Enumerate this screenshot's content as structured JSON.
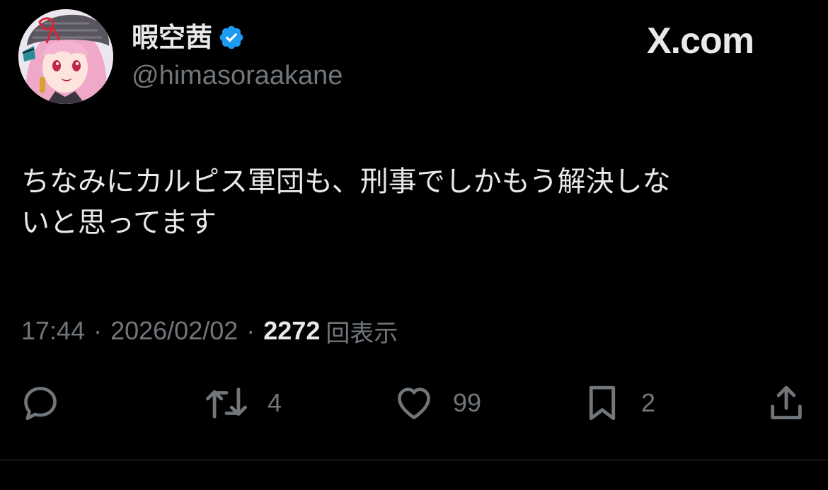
{
  "author": {
    "display_name": "暇空茜",
    "handle": "@himasoraakane",
    "verified": true,
    "avatar_icon": "anime-character-avatar"
  },
  "brand": {
    "label": "X.com"
  },
  "tweet": {
    "text": "ちなみにカルピス軍団も、刑事でしかもう解決しな\nいと思ってます"
  },
  "meta": {
    "time": "17:44",
    "separator": "·",
    "date": "2026/02/02",
    "views_count": "2272",
    "views_label": "回表示"
  },
  "actions": {
    "reply": {
      "icon": "reply-icon",
      "count": ""
    },
    "retweet": {
      "icon": "retweet-icon",
      "count": "4"
    },
    "like": {
      "icon": "heart-icon",
      "count": "99"
    },
    "bookmark": {
      "icon": "bookmark-icon",
      "count": "2"
    },
    "share": {
      "icon": "share-icon",
      "count": ""
    }
  },
  "colors": {
    "background": "#000000",
    "primary_text": "#e7e9ea",
    "secondary_text": "#71767b",
    "verified_blue": "#1d9bf0",
    "divider": "#2f3336"
  }
}
